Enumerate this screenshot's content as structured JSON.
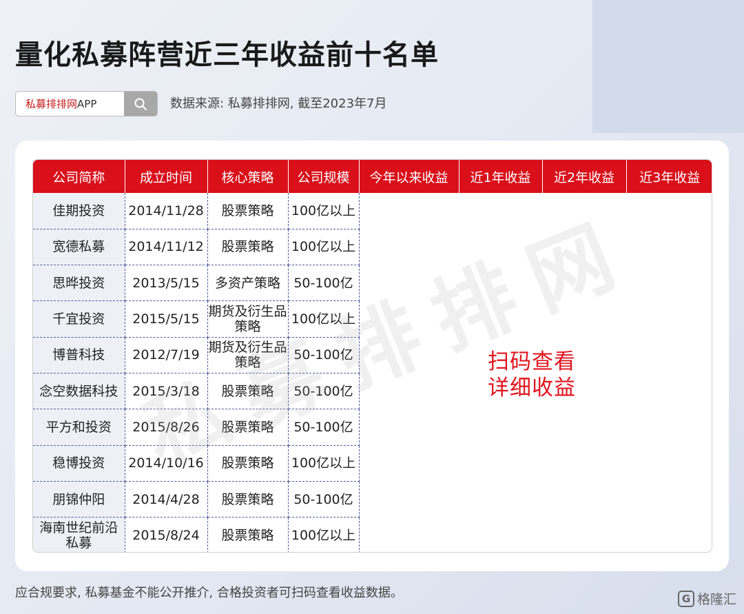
{
  "header": {
    "title": "量化私募阵营近三年收益前十名单",
    "search": {
      "brand": "私募排排网",
      "app": "APP"
    },
    "source": "数据来源: 私募排排网, 截至2023年7月"
  },
  "table": {
    "columns": [
      "公司简称",
      "成立时间",
      "核心策略",
      "公司规模",
      "今年以来收益",
      "近1年收益",
      "近2年收益",
      "近3年收益"
    ],
    "rows": [
      {
        "name": "佳期投资",
        "date": "2014/11/28",
        "strategy": "股票策略",
        "scale": "100亿以上"
      },
      {
        "name": "宽德私募",
        "date": "2014/11/12",
        "strategy": "股票策略",
        "scale": "100亿以上"
      },
      {
        "name": "思晔投资",
        "date": "2013/5/15",
        "strategy": "多资产策略",
        "scale": "50-100亿"
      },
      {
        "name": "千宜投资",
        "date": "2015/5/15",
        "strategy": "期货及衍生品策略",
        "scale": "100亿以上"
      },
      {
        "name": "博普科技",
        "date": "2012/7/19",
        "strategy": "期货及衍生品策略",
        "scale": "50-100亿"
      },
      {
        "name": "念空数据科技",
        "date": "2015/3/18",
        "strategy": "股票策略",
        "scale": "50-100亿"
      },
      {
        "name": "平方和投资",
        "date": "2015/8/26",
        "strategy": "股票策略",
        "scale": "50-100亿"
      },
      {
        "name": "稳博投资",
        "date": "2014/10/16",
        "strategy": "股票策略",
        "scale": "100亿以上"
      },
      {
        "name": "朋锦仲阳",
        "date": "2014/4/28",
        "strategy": "股票策略",
        "scale": "50-100亿"
      },
      {
        "name": "海南世纪前沿私募",
        "date": "2015/8/24",
        "strategy": "股票策略",
        "scale": "100亿以上"
      }
    ]
  },
  "scan_prompt": {
    "line1": "扫码查看",
    "line2": "详细收益"
  },
  "watermark": "私募排排网",
  "footer": {
    "note": "应合规要求, 私募基金不能公开推介, 合格投资者可扫码查看收益数据。",
    "logo_mark": "G",
    "logo_text": "格隆汇"
  },
  "colors": {
    "header_red": "#d9101a",
    "accent_red": "#e0141e",
    "name_cell_bg": "#eef0f6"
  },
  "icons": {
    "search": "search-icon"
  }
}
